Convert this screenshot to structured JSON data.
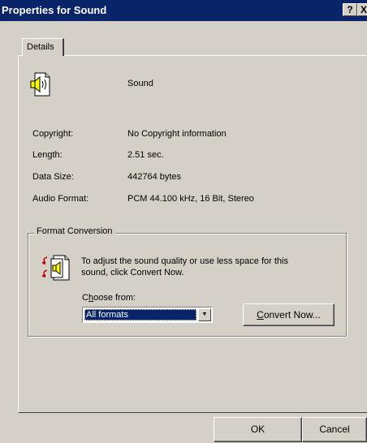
{
  "window": {
    "title": "Properties for Sound",
    "help_button": "?",
    "close_button": "X"
  },
  "tabs": [
    {
      "label": "Details",
      "selected": true
    }
  ],
  "file": {
    "icon": "sound-file-icon",
    "name": "Sound"
  },
  "properties": [
    {
      "label": "Copyright:",
      "value": "No Copyright information"
    },
    {
      "label": "Length:",
      "value": "2.51 sec."
    },
    {
      "label": "Data Size:",
      "value": "442764 bytes"
    },
    {
      "label": "Audio Format:",
      "value": "PCM 44.100 kHz, 16 Bit, Stereo"
    }
  ],
  "format_conversion": {
    "group_label": "Format Conversion",
    "icon": "convert-sound-icon",
    "description": "To adjust the sound quality or use less space for this sound, click Convert Now.",
    "choose_label_mnemonic": "h",
    "choose_label_prefix": "C",
    "choose_label_rest": "oose from:",
    "dropdown_value": "All formats",
    "convert_mnemonic": "C",
    "convert_rest": "onvert Now..."
  },
  "footer": {
    "ok_label": "OK",
    "cancel_label": "Cancel"
  },
  "colors": {
    "titlebar": "#0a246a",
    "face": "#d4d0c8"
  }
}
